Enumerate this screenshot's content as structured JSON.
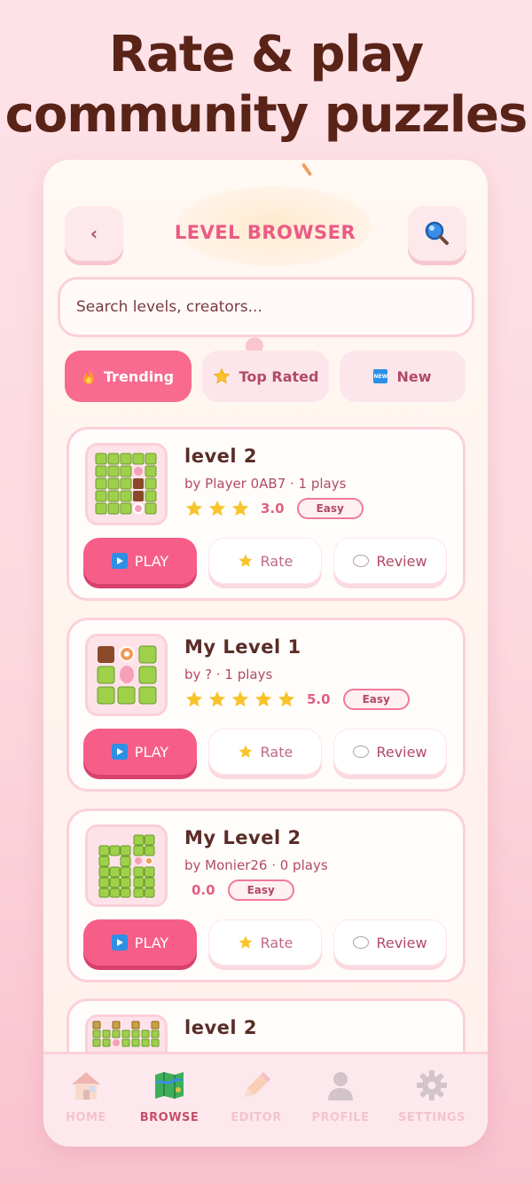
{
  "headline": {
    "line1": "Rate & play",
    "line2": "community puzzles"
  },
  "header": {
    "back_label": "‹",
    "title": "LEVEL BROWSER"
  },
  "search": {
    "placeholder": "Search levels, creators..."
  },
  "tabs": [
    {
      "label": "Trending",
      "icon": "fire-icon",
      "active": true
    },
    {
      "label": "Top Rated",
      "icon": "star-icon",
      "active": false
    },
    {
      "label": "New",
      "icon": "new-badge-icon",
      "active": false
    },
    {
      "new_badge_text": "NEW"
    }
  ],
  "levels": [
    {
      "name": "level 2",
      "meta": "by Player 0AB7 · 1 plays",
      "stars": 3,
      "rating": "3.0",
      "difficulty": "Easy"
    },
    {
      "name": "My Level 1",
      "meta": "by ? · 1 plays",
      "stars": 5,
      "rating": "5.0",
      "difficulty": "Easy"
    },
    {
      "name": "My Level 2",
      "meta": "by Monier26 · 0 plays",
      "stars": 0,
      "rating": "0.0",
      "difficulty": "Easy"
    },
    {
      "name": "level 2"
    }
  ],
  "actions": {
    "play": "PLAY",
    "rate": "Rate",
    "review": "Review"
  },
  "nav": [
    {
      "label": "HOME",
      "icon": "house-icon",
      "active": false
    },
    {
      "label": "BROWSE",
      "icon": "map-icon",
      "active": true
    },
    {
      "label": "EDITOR",
      "icon": "pencil-icon",
      "active": false
    },
    {
      "label": "PROFILE",
      "icon": "person-icon",
      "active": false
    },
    {
      "label": "SETTINGS",
      "icon": "gear-icon",
      "active": false
    }
  ],
  "colors": {
    "accent": "#f75d89",
    "title": "#ea5a86",
    "headline": "#5a2318",
    "star": "#f8c42c"
  }
}
